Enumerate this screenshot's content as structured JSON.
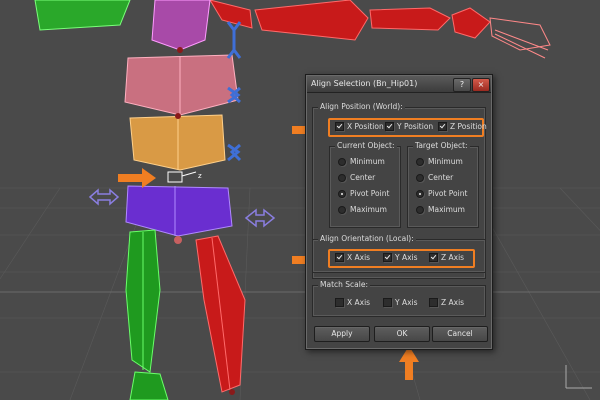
{
  "dialog": {
    "title": "Align Selection (Bn_Hip01)",
    "help_glyph": "?",
    "close_glyph": "×",
    "align_position": {
      "label": "Align Position (World):",
      "checks": [
        {
          "label": "X Position",
          "checked": true
        },
        {
          "label": "Y Position",
          "checked": true
        },
        {
          "label": "Z Position",
          "checked": true
        }
      ]
    },
    "current_object": {
      "label": "Current Object:",
      "options": [
        "Minimum",
        "Center",
        "Pivot Point",
        "Maximum"
      ],
      "selected": "Pivot Point"
    },
    "target_object": {
      "label": "Target Object:",
      "options": [
        "Minimum",
        "Center",
        "Pivot Point",
        "Maximum"
      ],
      "selected": "Pivot Point"
    },
    "align_orientation": {
      "label": "Align Orientation (Local):",
      "checks": [
        {
          "label": "X Axis",
          "checked": true
        },
        {
          "label": "Y Axis",
          "checked": true
        },
        {
          "label": "Z Axis",
          "checked": true
        }
      ]
    },
    "match_scale": {
      "label": "Match Scale:",
      "checks": [
        {
          "label": "X Axis",
          "checked": false
        },
        {
          "label": "Y Axis",
          "checked": false
        },
        {
          "label": "Z Axis",
          "checked": false
        }
      ]
    },
    "buttons": {
      "apply": "Apply",
      "ok": "OK",
      "cancel": "Cancel"
    }
  },
  "viewport": {
    "pivot_label": "z",
    "colors": {
      "highlight": "#f07e22",
      "gizmo_blue": "#3f6fd6",
      "gizmo_purple": "#8a7ee0",
      "bone_red": "#d81f1f",
      "bone_green": "#2aa82a",
      "bone_pink": "#c97080",
      "bone_purple": "#7a2ed6",
      "bone_orange": "#d99a45",
      "bone_magenta": "#a84aa8"
    }
  }
}
